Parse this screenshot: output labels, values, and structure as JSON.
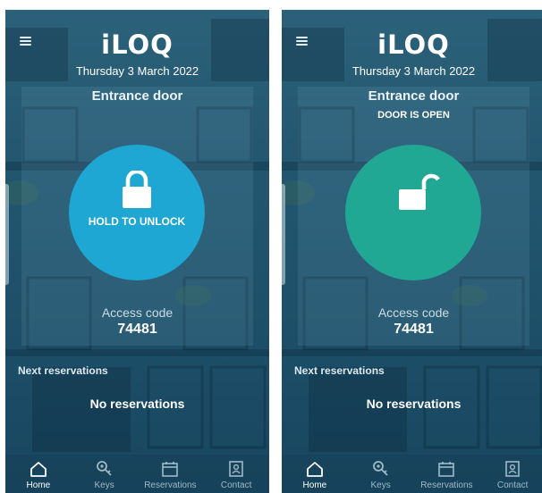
{
  "screens": [
    {
      "logo": "iLOQ",
      "date": "Thursday 3 March 2022",
      "door_name": "Entrance door",
      "door_status": "",
      "lock_button_label": "HOLD TO UNLOCK",
      "lock_state": "locked",
      "lock_color": "#1ea7d2",
      "access_code_label": "Access code",
      "access_code": "74481",
      "next_reservations_label": "Next reservations",
      "no_reservations_text": "No reservations",
      "nav": [
        {
          "label": "Home",
          "icon": "home-icon",
          "active": true
        },
        {
          "label": "Keys",
          "icon": "key-icon",
          "active": false
        },
        {
          "label": "Reservations",
          "icon": "calendar-icon",
          "active": false
        },
        {
          "label": "Contact",
          "icon": "contact-card-icon",
          "active": false
        }
      ]
    },
    {
      "logo": "iLOQ",
      "date": "Thursday 3 March 2022",
      "door_name": "Entrance door",
      "door_status": "DOOR IS OPEN",
      "lock_button_label": "",
      "lock_state": "unlocked",
      "lock_color": "#21a894",
      "access_code_label": "Access code",
      "access_code": "74481",
      "next_reservations_label": "Next reservations",
      "no_reservations_text": "No reservations",
      "nav": [
        {
          "label": "Home",
          "icon": "home-icon",
          "active": true
        },
        {
          "label": "Keys",
          "icon": "key-icon",
          "active": false
        },
        {
          "label": "Reservations",
          "icon": "calendar-icon",
          "active": false
        },
        {
          "label": "Contact",
          "icon": "contact-card-icon",
          "active": false
        }
      ]
    }
  ]
}
